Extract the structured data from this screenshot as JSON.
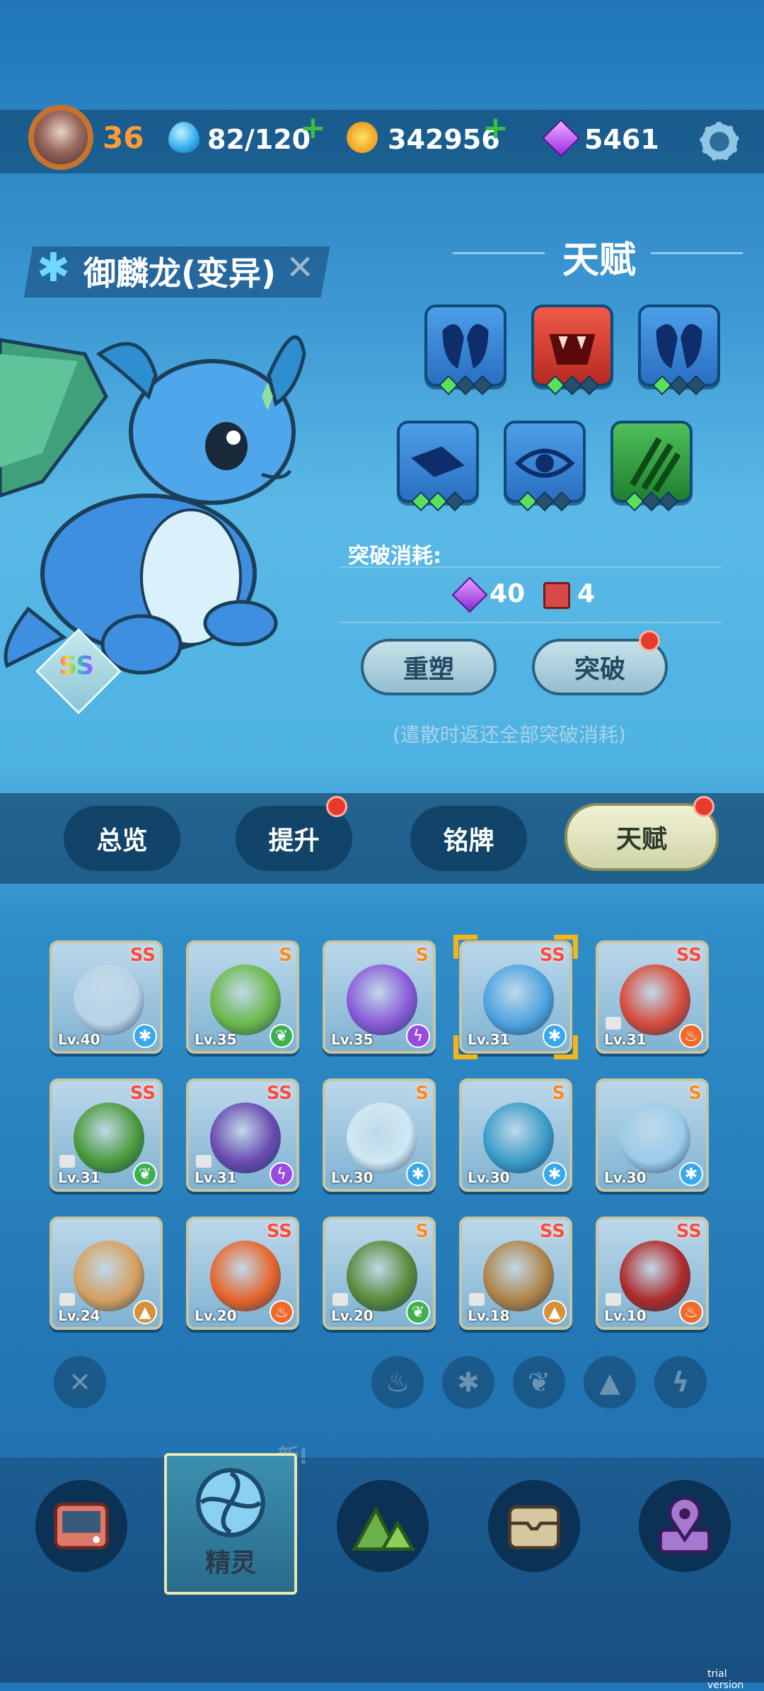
{
  "header": {
    "level": "36",
    "stamina": "82/120",
    "coins": "342956",
    "gems": "5461",
    "icons": {
      "avatar": "player-avatar",
      "stamina": "water-drop-icon",
      "coins": "paw-coin-icon",
      "gems": "purple-diamond-icon",
      "settings": "gear-icon",
      "plus": "plus-icon"
    }
  },
  "pet": {
    "name": "御麟龙(变异)",
    "rank": "SS",
    "element_icon": "snowflake-icon"
  },
  "talent": {
    "title": "天赋",
    "slots": [
      {
        "icon": "blue-wings-icon",
        "color": "#3e8fe0",
        "gems": [
          1,
          0,
          0
        ]
      },
      {
        "icon": "red-fangs-icon",
        "color": "#e0473a",
        "gems": [
          1,
          0,
          0
        ]
      },
      {
        "icon": "blue-wings-icon",
        "color": "#3e8fe0",
        "gems": [
          1,
          0,
          0
        ]
      },
      {
        "icon": "blue-scales-icon",
        "color": "#3e8fe0",
        "gems": [
          1,
          1,
          0
        ]
      },
      {
        "icon": "blue-eye-icon",
        "color": "#3e8fe0",
        "gems": [
          1,
          0,
          0
        ]
      },
      {
        "icon": "green-claw-icon",
        "color": "#3fb04c",
        "gems": [
          1,
          0,
          0
        ]
      }
    ],
    "cost_label": "突破消耗:",
    "cost_diamond": "40",
    "cost_book": "4",
    "reset_label": "重塑",
    "break_label": "突破",
    "hint": "(遣散时返还全部突破消耗)"
  },
  "tabs": [
    {
      "label": "总览",
      "dot": false,
      "active": false
    },
    {
      "label": "提升",
      "dot": true,
      "active": false
    },
    {
      "label": "铭牌",
      "dot": false,
      "active": false
    },
    {
      "label": "天赋",
      "dot": true,
      "active": true
    }
  ],
  "pets": [
    {
      "rank": "SS",
      "lv": "Lv.40",
      "elem": "ice",
      "color": "#b8d4e6",
      "locked": false
    },
    {
      "rank": "S",
      "lv": "Lv.35",
      "elem": "leaf",
      "color": "#6cb84a",
      "locked": false
    },
    {
      "rank": "S",
      "lv": "Lv.35",
      "elem": "bolt",
      "color": "#8a5ad8",
      "locked": false
    },
    {
      "rank": "SS",
      "lv": "Lv.31",
      "elem": "ice",
      "color": "#4fa3e0",
      "locked": false,
      "selected": true
    },
    {
      "rank": "SS",
      "lv": "Lv.31",
      "elem": "fire",
      "color": "#d84a3a",
      "locked": true
    },
    {
      "rank": "SS",
      "lv": "Lv.31",
      "elem": "leaf",
      "color": "#4c9a3a",
      "locked": true
    },
    {
      "rank": "SS",
      "lv": "Lv.31",
      "elem": "bolt",
      "color": "#6a4ab0",
      "locked": true
    },
    {
      "rank": "S",
      "lv": "Lv.30",
      "elem": "ice",
      "color": "#cfe8f4",
      "locked": false
    },
    {
      "rank": "S",
      "lv": "Lv.30",
      "elem": "ice",
      "color": "#3b9cc8",
      "locked": false
    },
    {
      "rank": "S",
      "lv": "Lv.30",
      "elem": "ice",
      "color": "#9ccbe8",
      "locked": false
    },
    {
      "rank": "",
      "lv": "Lv.24",
      "elem": "earth",
      "color": "#d6a060",
      "locked": true
    },
    {
      "rank": "SS",
      "lv": "Lv.20",
      "elem": "fire",
      "color": "#e8642a",
      "locked": false
    },
    {
      "rank": "S",
      "lv": "Lv.20",
      "elem": "leaf",
      "color": "#5a8a3a",
      "locked": true
    },
    {
      "rank": "SS",
      "lv": "Lv.18",
      "elem": "earth",
      "color": "#b08448",
      "locked": true
    },
    {
      "rank": "SS",
      "lv": "Lv.10",
      "elem": "fire",
      "color": "#b02a2a",
      "locked": true
    }
  ],
  "filters": {
    "clear_icon": "close-icon",
    "elements": [
      "fire-icon",
      "snowflake-icon",
      "leaf-icon",
      "earth-icon",
      "bolt-icon"
    ]
  },
  "bottom_nav": {
    "items": [
      {
        "icon": "computer-icon",
        "label": ""
      },
      {
        "icon": "spirit-icon",
        "label": "精灵",
        "active": true
      },
      {
        "icon": "mountain-icon",
        "label": ""
      },
      {
        "icon": "chest-icon",
        "label": ""
      },
      {
        "icon": "map-pin-icon",
        "label": ""
      }
    ],
    "new_tag": "新!"
  },
  "watermark": "trial version"
}
